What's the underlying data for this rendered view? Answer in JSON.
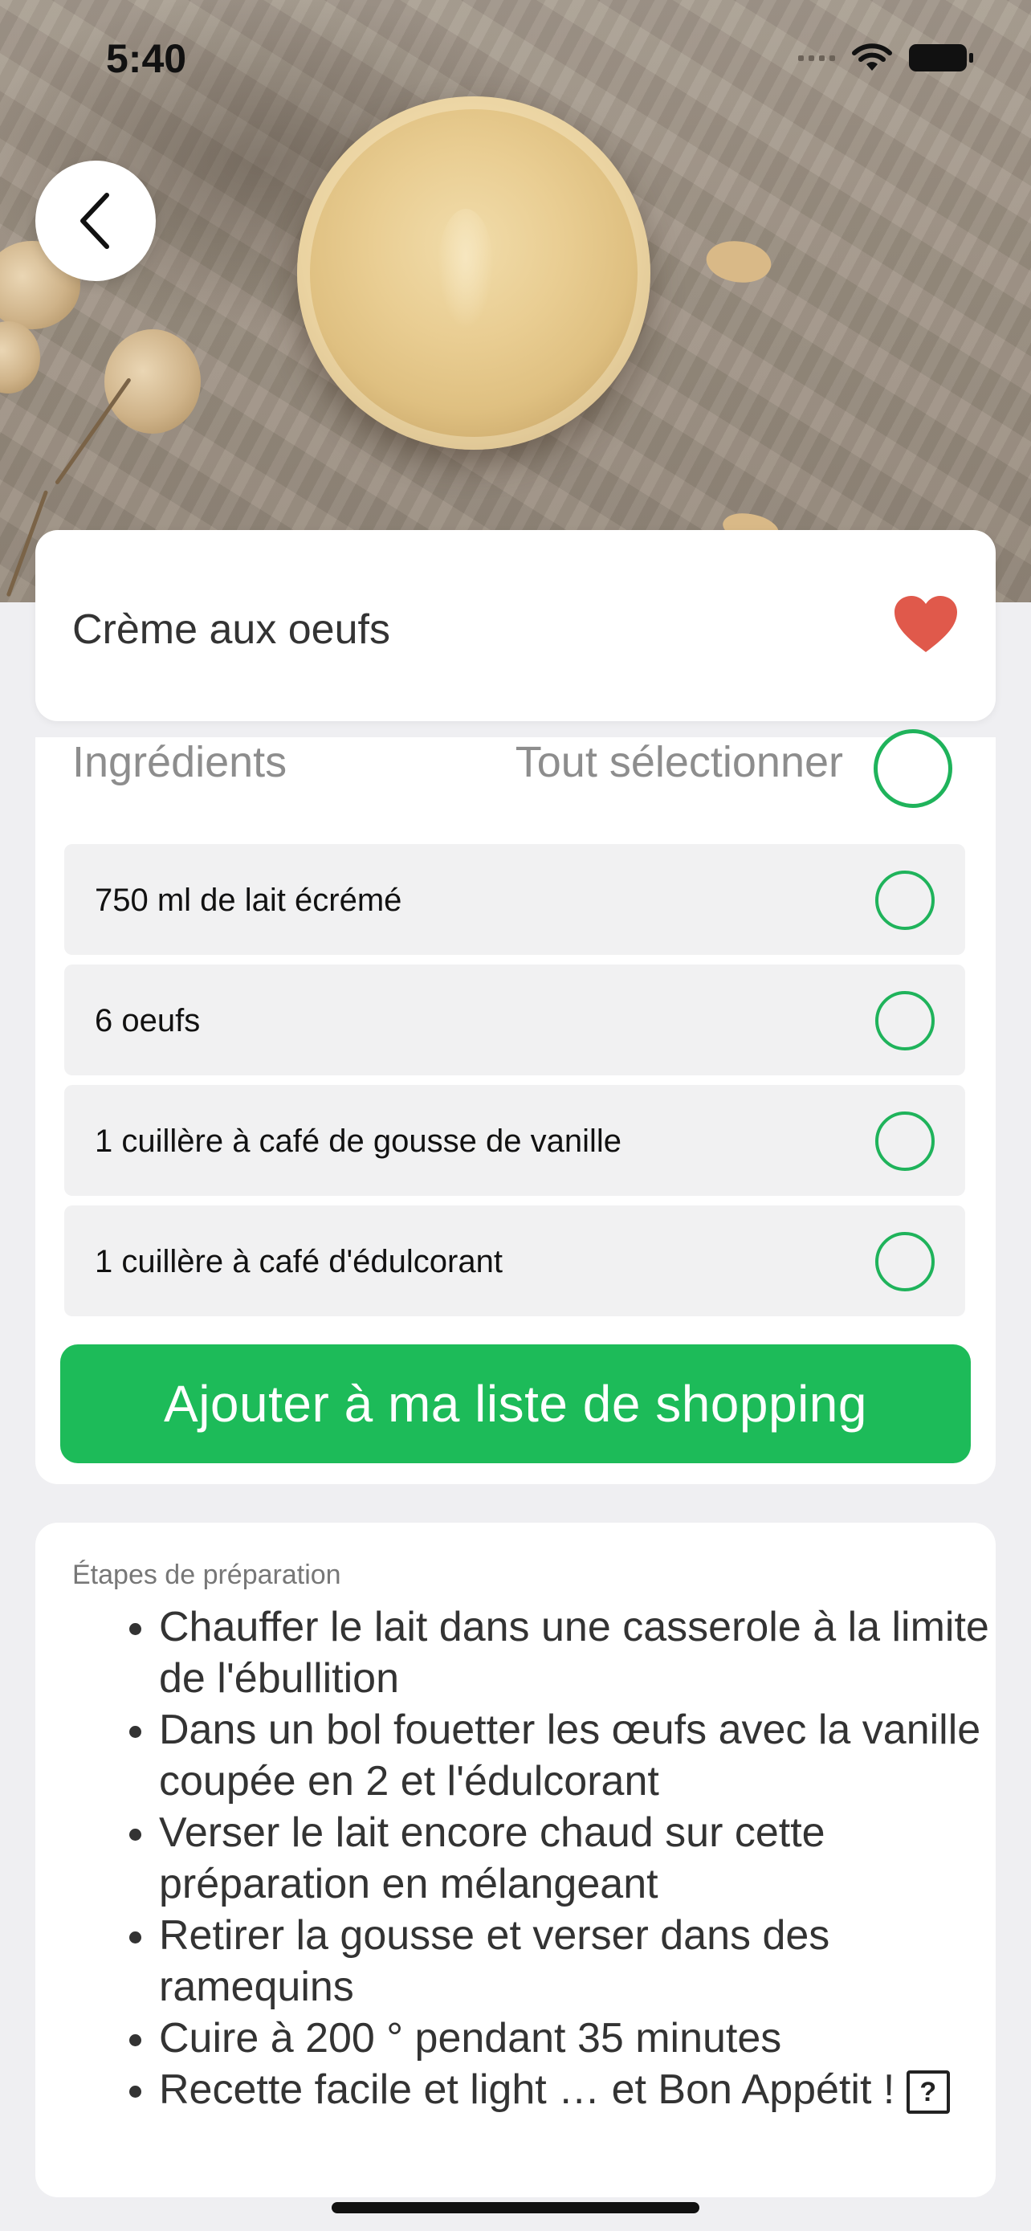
{
  "status_bar": {
    "time": "5:40"
  },
  "recipe": {
    "title": "Crème aux oeufs"
  },
  "ingredients": {
    "header": "Ingrédients",
    "select_all_label": "Tout sélectionner",
    "items": [
      {
        "label": "750 ml de lait écrémé"
      },
      {
        "label": "6 oeufs"
      },
      {
        "label": "1 cuillère à café de gousse de vanille"
      },
      {
        "label": "1 cuillère à café d'édulcorant"
      }
    ],
    "add_button_label": "Ajouter à ma liste de shopping"
  },
  "steps": {
    "label": "Étapes de préparation",
    "items": [
      "Chauffer le lait dans une casserole à la limite de l'ébullition",
      "Dans un bol fouetter les œufs avec la vanille coupée en 2 et l'édulcorant",
      "Verser le lait encore chaud sur cette préparation en mélangeant",
      "Retirer la gousse et verser dans des ramequins",
      "Cuire à 200 ° pendant 35 minutes",
      "Recette facile et light … et Bon Appétit !"
    ],
    "trailing_glyph": "?"
  },
  "colors": {
    "accent_green": "#1dbb59",
    "heart_red": "#e0594b",
    "background": "#efeff2"
  },
  "icons": [
    "back-chevron-icon",
    "heart-icon",
    "wifi-icon",
    "battery-icon",
    "signal-icon"
  ]
}
